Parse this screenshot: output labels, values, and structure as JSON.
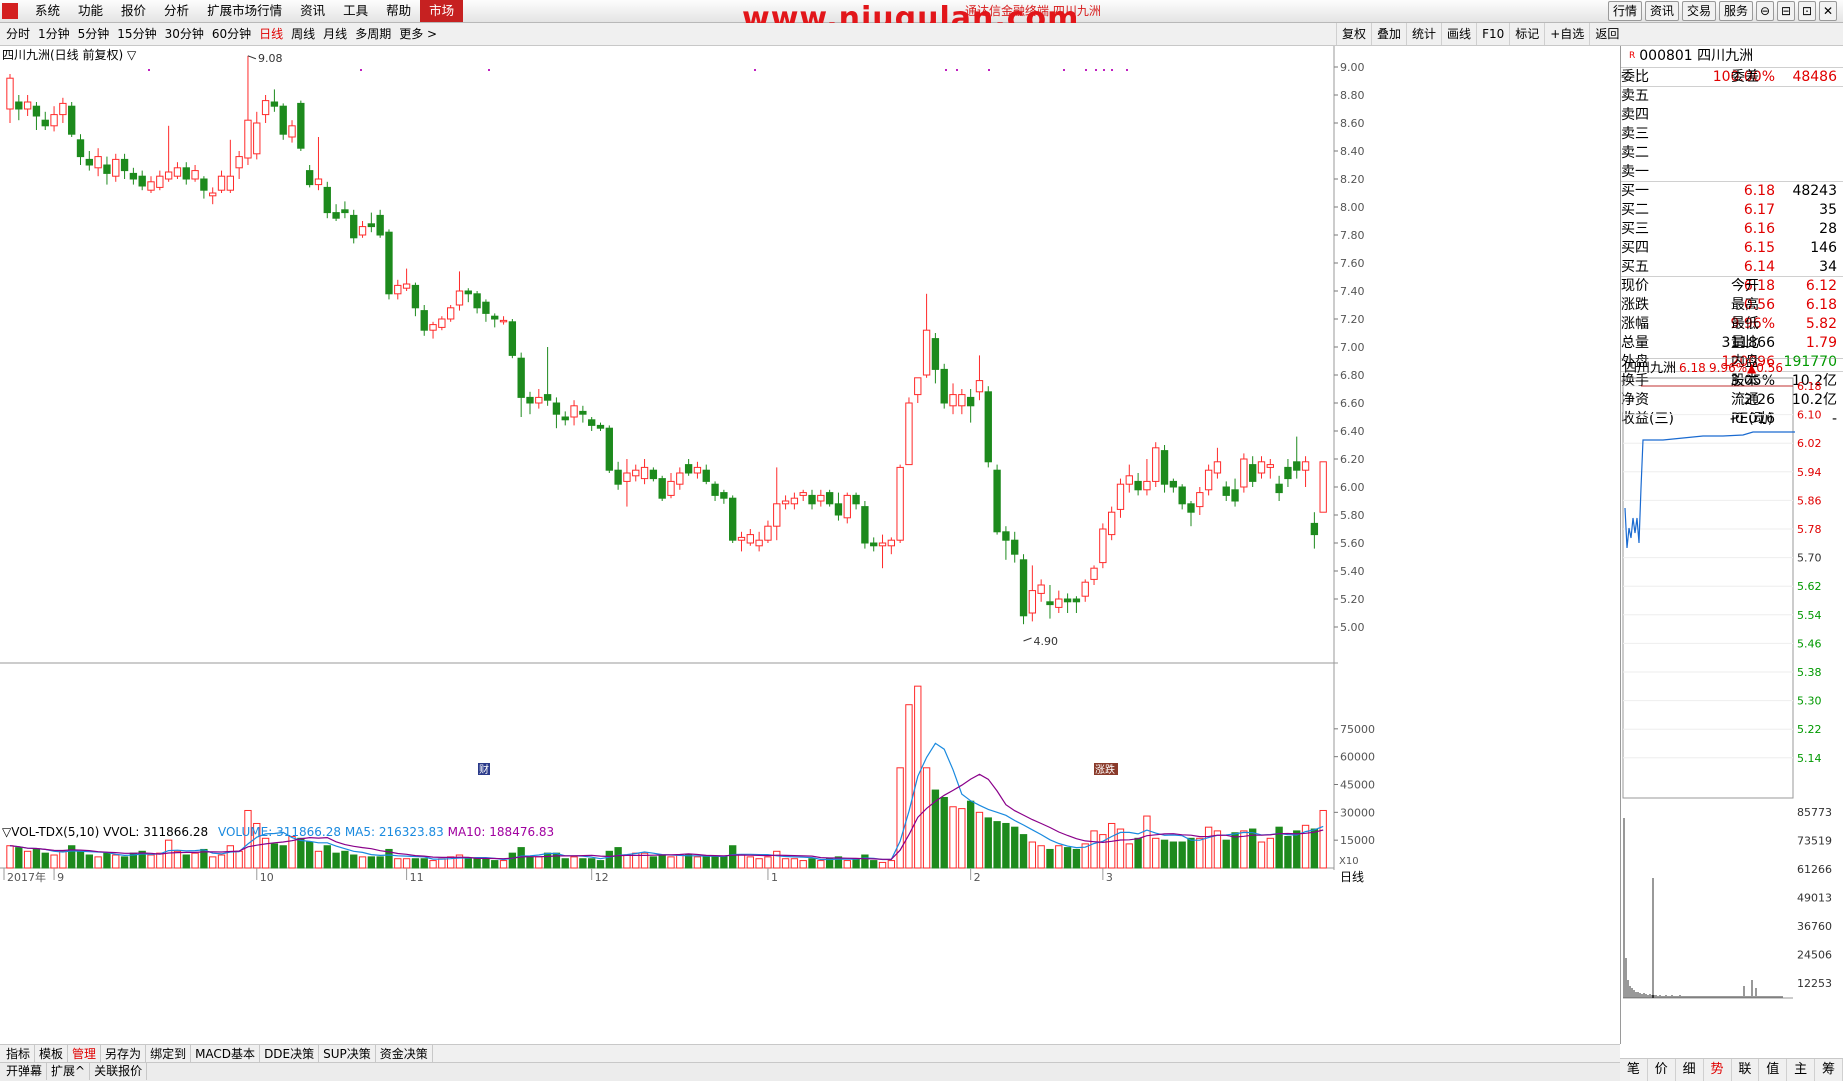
{
  "menubar": {
    "menus": [
      "系统",
      "功能",
      "报价",
      "分析",
      "扩展市场行情",
      "资讯",
      "工具",
      "帮助",
      "市场"
    ],
    "active_menu": "市场",
    "title": "通达信金融终端 四川九洲",
    "watermark": "www.niugulan.com",
    "right_buttons": [
      "行情",
      "资讯",
      "交易",
      "服务"
    ],
    "window_controls": [
      "⊖",
      "⊟",
      "⊡",
      "✕"
    ]
  },
  "periodbar": {
    "tabs": [
      "分时",
      "1分钟",
      "5分钟",
      "15分钟",
      "30分钟",
      "60分钟",
      "日线",
      "周线",
      "月线",
      "多周期",
      "更多 >"
    ],
    "active": "日线",
    "tools": [
      "复权",
      "叠加",
      "统计",
      "画线",
      "F10",
      "标记",
      "+自选",
      "返回"
    ]
  },
  "main_chart": {
    "label": "四川九洲(日线 前复权) ▽",
    "high_label": "9.08",
    "low_label": "4.90",
    "marker_cai": "财",
    "marker_zhang": "涨跌",
    "price_axis": [
      "9.00",
      "8.80",
      "8.60",
      "8.40",
      "8.20",
      "8.00",
      "7.80",
      "7.60",
      "7.40",
      "7.20",
      "7.00",
      "6.80",
      "6.60",
      "6.40",
      "6.20",
      "6.00",
      "5.80",
      "5.60",
      "5.40",
      "5.20",
      "5.00"
    ],
    "volume_label": "▽VOL-TDX(5,10) VVOL: 311866.28",
    "volume_v1": "VOLUME: 311866.28",
    "volume_ma5": "MA5: 216323.83",
    "volume_ma10": "MA10: 188476.83",
    "volume_axis": [
      "75000",
      "60000",
      "45000",
      "30000",
      "15000"
    ],
    "volume_unit": "X10",
    "date_axis": [
      "2017年",
      "9",
      "10",
      "11",
      "12",
      "1",
      "2",
      "3"
    ],
    "date_period": "日线"
  },
  "right_panel": {
    "code_flag": "R",
    "code": "000801",
    "name": "四川九洲",
    "weibi_label": "委比",
    "weibi_value": "100.00%",
    "weicha_label": "委差",
    "weicha_value": "48486",
    "sell": [
      {
        "label": "卖五",
        "price": "",
        "vol": ""
      },
      {
        "label": "卖四",
        "price": "",
        "vol": ""
      },
      {
        "label": "卖三",
        "price": "",
        "vol": ""
      },
      {
        "label": "卖二",
        "price": "",
        "vol": ""
      },
      {
        "label": "卖一",
        "price": "",
        "vol": ""
      }
    ],
    "buy": [
      {
        "label": "买一",
        "price": "6.18",
        "vol": "48243"
      },
      {
        "label": "买二",
        "price": "6.17",
        "vol": "35"
      },
      {
        "label": "买三",
        "price": "6.16",
        "vol": "28"
      },
      {
        "label": "买四",
        "price": "6.15",
        "vol": "146"
      },
      {
        "label": "买五",
        "price": "6.14",
        "vol": "34"
      }
    ],
    "stats": [
      {
        "k1": "现价",
        "v1": "6.18",
        "k2": "今开",
        "v2": "6.12"
      },
      {
        "k1": "涨跌",
        "v1": "0.56",
        "k2": "最高",
        "v2": "6.18"
      },
      {
        "k1": "涨幅",
        "v1": "9.96%",
        "k2": "最低",
        "v2": "5.82"
      },
      {
        "k1": "总量",
        "v1": "311866",
        "k2": "量比",
        "v2": "1.79"
      },
      {
        "k1": "外盘",
        "v1": "120096",
        "k2": "内盘",
        "v2": "191770"
      }
    ],
    "stats2": [
      {
        "k1": "换手",
        "v1": "3.05%",
        "k2": "股本",
        "v2": "10.2亿"
      },
      {
        "k1": "净资",
        "v1": "2.26",
        "k2": "流通",
        "v2": "10.2亿"
      },
      {
        "k1": "收益(三)",
        "v1": "-0.016",
        "k2": "PE(动)",
        "v2": "-"
      }
    ],
    "mini_title": "四川九洲",
    "mini_price": "6.18",
    "mini_pct": "9.96%",
    "mini_change": "▲0.56",
    "mini_price_axis": [
      "6.18",
      "6.10",
      "6.02",
      "5.94",
      "5.86",
      "5.78",
      "5.70",
      "5.62",
      "5.54",
      "5.46",
      "5.38",
      "5.30",
      "5.22",
      "5.14"
    ],
    "mini_vol_axis": [
      "85773",
      "73519",
      "61266",
      "49013",
      "36760",
      "24506",
      "12253"
    ]
  },
  "bottom_tabs": [
    "指标",
    "模板",
    "管理",
    "另存为",
    "绑定到",
    "MACD基本",
    "DDE决策",
    "SUP决策",
    "资金决策"
  ],
  "bottom_tabs_active": "管理",
  "bottom_tabs2": [
    "开弹幕",
    "扩展^",
    "关联报价"
  ],
  "right_tabs": [
    "笔",
    "价",
    "细",
    "势",
    "联",
    "值",
    "主",
    "筹"
  ],
  "right_tabs_active": "势",
  "chart_data": {
    "type": "candlestick",
    "title": "四川九洲(日线 前复权)",
    "ylim": [
      4.75,
      9.2
    ],
    "candles": [
      [
        8.7,
        8.92,
        8.6,
        8.95
      ],
      [
        8.75,
        8.7,
        8.62,
        8.8
      ],
      [
        8.7,
        8.75,
        8.65,
        8.8
      ],
      [
        8.72,
        8.65,
        8.55,
        8.75
      ],
      [
        8.62,
        8.58,
        8.55,
        8.68
      ],
      [
        8.58,
        8.66,
        8.54,
        8.72
      ],
      [
        8.66,
        8.74,
        8.6,
        8.78
      ],
      [
        8.72,
        8.52,
        8.5,
        8.75
      ],
      [
        8.48,
        8.36,
        8.3,
        8.52
      ],
      [
        8.34,
        8.3,
        8.26,
        8.4
      ],
      [
        8.28,
        8.36,
        8.22,
        8.42
      ],
      [
        8.3,
        8.24,
        8.16,
        8.36
      ],
      [
        8.22,
        8.34,
        8.18,
        8.38
      ],
      [
        8.34,
        8.26,
        8.2,
        8.38
      ],
      [
        8.24,
        8.2,
        8.16,
        8.28
      ],
      [
        8.22,
        8.15,
        8.12,
        8.26
      ],
      [
        8.12,
        8.18,
        8.1,
        8.22
      ],
      [
        8.14,
        8.22,
        8.12,
        8.26
      ],
      [
        8.2,
        8.25,
        8.18,
        8.58
      ],
      [
        8.22,
        8.28,
        8.2,
        8.32
      ],
      [
        8.28,
        8.2,
        8.16,
        8.32
      ],
      [
        8.2,
        8.26,
        8.18,
        8.3
      ],
      [
        8.2,
        8.12,
        8.06,
        8.22
      ],
      [
        8.08,
        8.1,
        8.02,
        8.14
      ],
      [
        8.12,
        8.22,
        8.1,
        8.26
      ],
      [
        8.12,
        8.22,
        8.1,
        8.48
      ],
      [
        8.28,
        8.36,
        8.2,
        8.4
      ],
      [
        8.35,
        8.62,
        8.3,
        9.08
      ],
      [
        8.38,
        8.6,
        8.34,
        8.68
      ],
      [
        8.66,
        8.76,
        8.6,
        8.8
      ],
      [
        8.75,
        8.72,
        8.68,
        8.84
      ],
      [
        8.72,
        8.52,
        8.48,
        8.74
      ],
      [
        8.5,
        8.58,
        8.46,
        8.62
      ],
      [
        8.74,
        8.42,
        8.4,
        8.76
      ],
      [
        8.26,
        8.16,
        8.14,
        8.3
      ],
      [
        8.16,
        8.2,
        8.12,
        8.5
      ],
      [
        8.14,
        7.96,
        7.92,
        8.18
      ],
      [
        7.96,
        7.92,
        7.9,
        8.02
      ],
      [
        7.98,
        7.96,
        7.92,
        8.04
      ],
      [
        7.94,
        7.78,
        7.74,
        7.98
      ],
      [
        7.8,
        7.86,
        7.78,
        7.9
      ],
      [
        7.88,
        7.86,
        7.82,
        7.96
      ],
      [
        7.94,
        7.8,
        7.78,
        7.98
      ],
      [
        7.82,
        7.38,
        7.34,
        7.84
      ],
      [
        7.38,
        7.44,
        7.34,
        7.48
      ],
      [
        7.42,
        7.45,
        7.4,
        7.56
      ],
      [
        7.44,
        7.28,
        7.22,
        7.46
      ],
      [
        7.26,
        7.12,
        7.08,
        7.3
      ],
      [
        7.12,
        7.16,
        7.06,
        7.18
      ],
      [
        7.14,
        7.2,
        7.12,
        7.22
      ],
      [
        7.2,
        7.28,
        7.18,
        7.3
      ],
      [
        7.3,
        7.4,
        7.26,
        7.54
      ],
      [
        7.4,
        7.38,
        7.32,
        7.42
      ],
      [
        7.38,
        7.28,
        7.24,
        7.4
      ],
      [
        7.32,
        7.24,
        7.18,
        7.34
      ],
      [
        7.22,
        7.2,
        7.14,
        7.24
      ],
      [
        7.18,
        7.19,
        7.16,
        7.22
      ],
      [
        7.18,
        6.94,
        6.92,
        7.2
      ],
      [
        6.92,
        6.64,
        6.5,
        6.96
      ],
      [
        6.64,
        6.6,
        6.52,
        6.68
      ],
      [
        6.6,
        6.64,
        6.56,
        6.7
      ],
      [
        6.66,
        6.62,
        6.58,
        7.0
      ],
      [
        6.6,
        6.52,
        6.42,
        6.64
      ],
      [
        6.5,
        6.48,
        6.44,
        6.54
      ],
      [
        6.5,
        6.58,
        6.44,
        6.62
      ],
      [
        6.54,
        6.52,
        6.46,
        6.58
      ],
      [
        6.48,
        6.44,
        6.4,
        6.5
      ],
      [
        6.44,
        6.42,
        6.4,
        6.46
      ],
      [
        6.42,
        6.12,
        6.1,
        6.44
      ],
      [
        6.12,
        6.02,
        5.98,
        6.18
      ],
      [
        6.04,
        6.1,
        5.86,
        6.2
      ],
      [
        6.08,
        6.12,
        6.04,
        6.16
      ],
      [
        6.06,
        6.14,
        6.02,
        6.2
      ],
      [
        6.12,
        6.06,
        6.04,
        6.14
      ],
      [
        6.06,
        5.92,
        5.9,
        6.08
      ],
      [
        5.94,
        6.04,
        5.92,
        6.1
      ],
      [
        6.02,
        6.1,
        5.98,
        6.14
      ],
      [
        6.16,
        6.1,
        6.08,
        6.2
      ],
      [
        6.1,
        6.14,
        6.06,
        6.18
      ],
      [
        6.12,
        6.04,
        6.02,
        6.16
      ],
      [
        6.02,
        5.94,
        5.9,
        6.04
      ],
      [
        5.96,
        5.92,
        5.88,
        5.98
      ],
      [
        5.92,
        5.62,
        5.6,
        5.94
      ],
      [
        5.62,
        5.64,
        5.54,
        5.68
      ],
      [
        5.6,
        5.66,
        5.58,
        5.7
      ],
      [
        5.58,
        5.62,
        5.54,
        5.68
      ],
      [
        5.62,
        5.72,
        5.6,
        5.76
      ],
      [
        5.72,
        5.88,
        5.62,
        6.14
      ],
      [
        5.88,
        5.9,
        5.84,
        5.94
      ],
      [
        5.88,
        5.92,
        5.84,
        5.96
      ],
      [
        5.94,
        5.96,
        5.9,
        5.98
      ],
      [
        5.94,
        5.88,
        5.84,
        5.98
      ],
      [
        5.9,
        5.94,
        5.86,
        5.98
      ],
      [
        5.96,
        5.88,
        5.86,
        5.98
      ],
      [
        5.88,
        5.8,
        5.76,
        5.96
      ],
      [
        5.78,
        5.94,
        5.74,
        5.96
      ],
      [
        5.94,
        5.88,
        5.84,
        5.96
      ],
      [
        5.86,
        5.6,
        5.56,
        5.9
      ],
      [
        5.6,
        5.58,
        5.54,
        5.64
      ],
      [
        5.58,
        5.6,
        5.42,
        5.66
      ],
      [
        5.58,
        5.62,
        5.52,
        5.64
      ],
      [
        5.62,
        6.14,
        5.6,
        6.16
      ],
      [
        6.16,
        6.6,
        6.3,
        6.64
      ],
      [
        6.66,
        6.78,
        6.6,
        6.76
      ],
      [
        6.8,
        7.12,
        6.78,
        7.38
      ],
      [
        7.06,
        6.84,
        6.74,
        7.1
      ],
      [
        6.84,
        6.6,
        6.56,
        6.88
      ],
      [
        6.58,
        6.66,
        6.52,
        6.74
      ],
      [
        6.58,
        6.66,
        6.52,
        6.7
      ],
      [
        6.64,
        6.58,
        6.46,
        6.7
      ],
      [
        6.68,
        6.76,
        6.62,
        6.94
      ],
      [
        6.68,
        6.18,
        6.14,
        6.72
      ],
      [
        6.12,
        5.68,
        5.66,
        6.16
      ],
      [
        5.68,
        5.62,
        5.48,
        5.72
      ],
      [
        5.62,
        5.52,
        5.46,
        5.68
      ],
      [
        5.48,
        5.08,
        5.02,
        5.52
      ],
      [
        5.1,
        5.26,
        5.04,
        5.44
      ],
      [
        5.24,
        5.3,
        5.18,
        5.34
      ],
      [
        5.18,
        5.16,
        5.06,
        5.3
      ],
      [
        5.14,
        5.2,
        5.1,
        5.26
      ],
      [
        5.2,
        5.18,
        5.1,
        5.24
      ],
      [
        5.2,
        5.18,
        5.1,
        5.22
      ],
      [
        5.22,
        5.32,
        5.18,
        5.34
      ],
      [
        5.34,
        5.42,
        5.3,
        5.44
      ],
      [
        5.46,
        5.7,
        5.42,
        5.74
      ],
      [
        5.66,
        5.82,
        5.62,
        5.86
      ],
      [
        5.84,
        6.02,
        5.78,
        6.06
      ],
      [
        6.02,
        6.08,
        5.96,
        6.16
      ],
      [
        6.04,
        5.98,
        5.94,
        6.1
      ],
      [
        5.98,
        6.04,
        5.94,
        6.2
      ],
      [
        6.04,
        6.28,
        6.0,
        6.32
      ],
      [
        6.26,
        6.02,
        5.96,
        6.3
      ],
      [
        6.04,
        6.0,
        5.96,
        6.06
      ],
      [
        6.0,
        5.88,
        5.84,
        6.02
      ],
      [
        5.88,
        5.82,
        5.72,
        5.9
      ],
      [
        5.86,
        5.96,
        5.8,
        6.0
      ],
      [
        5.98,
        6.12,
        5.94,
        6.16
      ],
      [
        6.1,
        6.18,
        6.06,
        6.28
      ],
      [
        6.0,
        5.94,
        5.9,
        6.04
      ],
      [
        5.98,
        5.9,
        5.86,
        6.06
      ],
      [
        6.0,
        6.2,
        5.96,
        6.24
      ],
      [
        6.16,
        6.04,
        6.0,
        6.22
      ],
      [
        6.1,
        6.18,
        6.06,
        6.22
      ],
      [
        6.14,
        6.16,
        6.06,
        6.2
      ],
      [
        6.02,
        5.96,
        5.9,
        6.08
      ],
      [
        6.14,
        6.06,
        6.0,
        6.2
      ],
      [
        6.18,
        6.12,
        6.06,
        6.36
      ],
      [
        6.12,
        6.18,
        6.0,
        6.22
      ],
      [
        5.74,
        5.66,
        5.56,
        5.82
      ],
      [
        5.82,
        6.18,
        5.82,
        6.18
      ]
    ],
    "volume": [
      12000,
      11000,
      9000,
      10000,
      8000,
      7000,
      9000,
      12000,
      9000,
      7000,
      6000,
      8000,
      7000,
      6000,
      8000,
      9000,
      7000,
      8000,
      15000,
      9000,
      7000,
      8000,
      10000,
      6000,
      7000,
      12000,
      9000,
      31000,
      24000,
      16000,
      13000,
      12000,
      17000,
      16000,
      14000,
      9000,
      12000,
      8000,
      9000,
      7000,
      6000,
      6000,
      6000,
      10000,
      5000,
      5000,
      5000,
      5000,
      4000,
      5000,
      6000,
      7000,
      5000,
      5000,
      5000,
      4000,
      4000,
      8000,
      11000,
      6000,
      6000,
      8000,
      8000,
      5000,
      6000,
      5000,
      5000,
      4000,
      9000,
      11000,
      7000,
      8000,
      8000,
      6000,
      7000,
      6000,
      7000,
      7000,
      6000,
      6000,
      6000,
      6000,
      12000,
      7000,
      6000,
      5000,
      6000,
      9000,
      5000,
      5000,
      4000,
      5000,
      4000,
      5000,
      6000,
      4000,
      5000,
      7000,
      4000,
      3000,
      4000,
      54000,
      88000,
      98000,
      54000,
      42000,
      38000,
      33000,
      32000,
      36000,
      30000,
      27000,
      25000,
      24000,
      22000,
      18000,
      14000,
      12000,
      10000,
      12000,
      11000,
      10000,
      13000,
      20000,
      18000,
      24000,
      21000,
      13000,
      16000,
      28000,
      16000,
      15000,
      14000,
      14000,
      16000,
      16000,
      22000,
      20000,
      15000,
      19000,
      20000,
      21000,
      14000,
      16000,
      22000,
      17000,
      20000,
      23000,
      21000,
      31000
    ],
    "vol_ylim": [
      0,
      90000
    ],
    "date_ticks": [
      {
        "label": "2017年",
        "index": 0
      },
      {
        "label": "9",
        "index": 5
      },
      {
        "label": "10",
        "index": 28
      },
      {
        "label": "11",
        "index": 45
      },
      {
        "label": "12",
        "index": 66
      },
      {
        "label": "1",
        "index": 86
      },
      {
        "label": "2",
        "index": 109
      },
      {
        "label": "3",
        "index": 124
      }
    ]
  },
  "colors": {
    "up": "#ff2a2a",
    "down": "#1d8a1d",
    "ma5": "#1a8adf",
    "ma10": "#8a008a",
    "axis_text": "#555555",
    "grid": "#e4e4e4"
  }
}
